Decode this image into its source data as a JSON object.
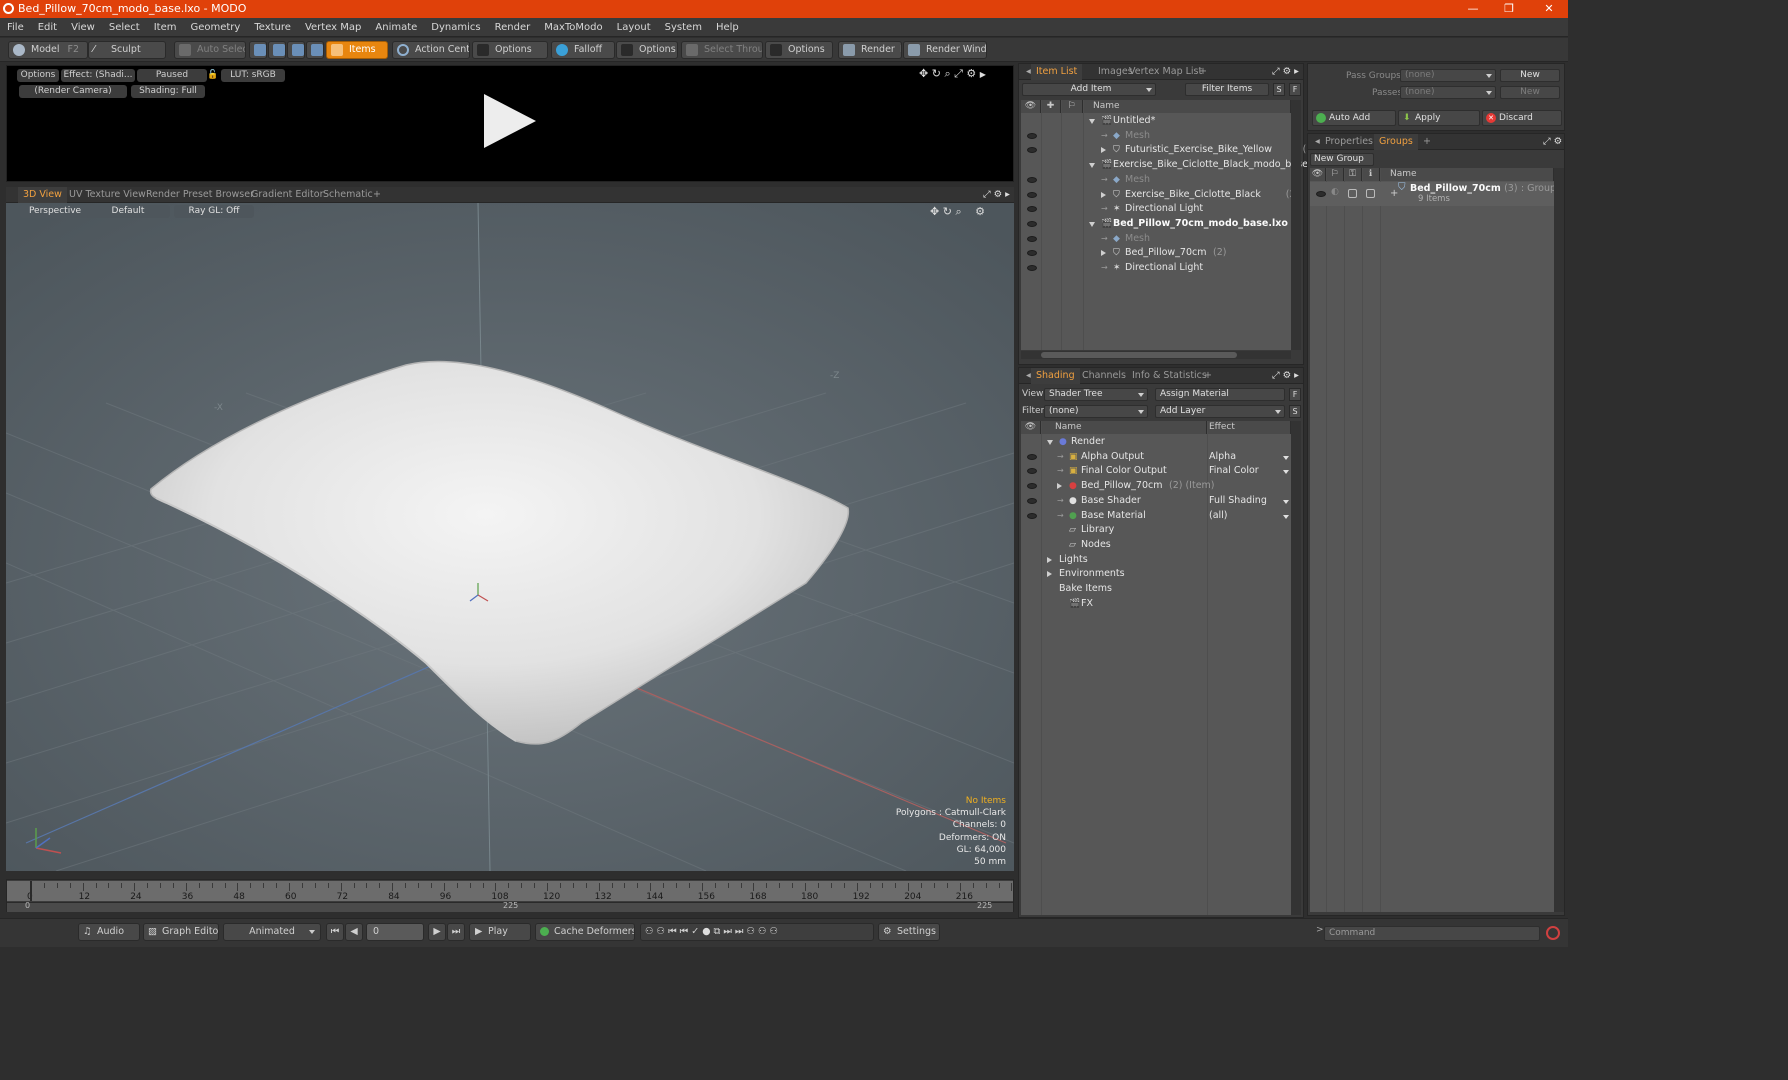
{
  "window": {
    "title": "Bed_Pillow_70cm_modo_base.lxo - MODO",
    "minimize": "—",
    "maximize": "❐",
    "close": "✕"
  },
  "menu": [
    "File",
    "Edit",
    "View",
    "Select",
    "Item",
    "Geometry",
    "Texture",
    "Vertex Map",
    "Animate",
    "Dynamics",
    "Render",
    "MaxToModo",
    "Layout",
    "System",
    "Help"
  ],
  "toolbar": {
    "model": "Model",
    "model_key": "F2",
    "sculpt": "Sculpt",
    "auto_select": "Auto Select",
    "items": "Items",
    "action_center": "Action Center",
    "options1": "Options",
    "falloff": "Falloff",
    "options2": "Options",
    "select_through": "Select Through",
    "options3": "Options",
    "render": "Render",
    "render_key": "F9",
    "render_window": "Render Window"
  },
  "preview": {
    "options": "Options",
    "effect": "Effect: (Shadi...",
    "paused": "Paused",
    "lut": "LUT: sRGB",
    "camera": "(Render Camera)",
    "shading": "Shading: Full"
  },
  "view_tabs": [
    "3D View",
    "UV Texture View",
    "Render Preset Browser",
    "Gradient Editor",
    "Schematic",
    "+"
  ],
  "viewport": {
    "perspective": "Perspective",
    "default": "Default",
    "raygl": "Ray GL: Off",
    "axis_x": "-X",
    "axis_z": "-Z",
    "stats": {
      "no_items": "No Items",
      "polygons": "Polygons : Catmull-Clark",
      "channels": "Channels: 0",
      "deformers": "Deformers: ON",
      "gl": "GL: 64,000",
      "lens": "50 mm"
    }
  },
  "timeline": {
    "ticks": [
      "0",
      "12",
      "24",
      "36",
      "48",
      "60",
      "72",
      "84",
      "96",
      "108",
      "120",
      "132",
      "144",
      "156",
      "168",
      "180",
      "192",
      "204",
      "216"
    ],
    "start": "0",
    "mid": "225",
    "end": "225"
  },
  "bottom": {
    "audio": "Audio",
    "graph_editor": "Graph Editor",
    "animated": "Animated",
    "frame": "0",
    "play": "Play",
    "cache_deformers": "Cache Deformers",
    "settings": "Settings"
  },
  "item_list": {
    "tabs": [
      "Item List",
      "Images",
      "Vertex Map List",
      "+"
    ],
    "add_item": "Add Item",
    "filter_items": "Filter Items",
    "s": "S",
    "f": "F",
    "name_header": "Name",
    "rows": [
      {
        "label": "Untitled*",
        "cnt": ""
      },
      {
        "label": "Mesh",
        "cnt": ""
      },
      {
        "label": "Futuristic_Exercise_Bike_Yellow",
        "cnt": "(2)"
      },
      {
        "label": "Exercise_Bike_Ciclotte_Black_modo_base....",
        "cnt": ""
      },
      {
        "label": "Mesh",
        "cnt": ""
      },
      {
        "label": "Exercise_Bike_Ciclotte_Black",
        "cnt": "(2)"
      },
      {
        "label": "Directional Light",
        "cnt": ""
      },
      {
        "label": "Bed_Pillow_70cm_modo_base.lxo",
        "cnt": ""
      },
      {
        "label": "Mesh",
        "cnt": ""
      },
      {
        "label": "Bed_Pillow_70cm",
        "cnt": "(2)"
      },
      {
        "label": "Directional Light",
        "cnt": ""
      }
    ]
  },
  "shading": {
    "tabs": [
      "Shading",
      "Channels",
      "Info & Statistics",
      "+"
    ],
    "view_label": "View",
    "view_value": "Shader Tree",
    "assign_material": "Assign Material",
    "f": "F",
    "filter_label": "Filter",
    "filter_value": "(none)",
    "add_layer": "Add Layer",
    "s": "S",
    "name_header": "Name",
    "effect_header": "Effect",
    "rows": [
      {
        "label": "Render",
        "effect": ""
      },
      {
        "label": "Alpha Output",
        "effect": "Alpha"
      },
      {
        "label": "Final Color Output",
        "effect": "Final Color"
      },
      {
        "label": "Bed_Pillow_70cm",
        "cnt": "(2) (Item)",
        "effect": ""
      },
      {
        "label": "Base Shader",
        "effect": "Full Shading"
      },
      {
        "label": "Base Material",
        "effect": "(all)"
      },
      {
        "label": "Library",
        "effect": ""
      },
      {
        "label": "Nodes",
        "effect": ""
      },
      {
        "label": "Lights",
        "effect": ""
      },
      {
        "label": "Environments",
        "effect": ""
      },
      {
        "label": "Bake Items",
        "effect": ""
      },
      {
        "label": "FX",
        "effect": ""
      }
    ]
  },
  "pass": {
    "pass_groups": "Pass Groups",
    "passes": "Passes",
    "none1": "(none)",
    "none2": "(none)",
    "new1": "New",
    "new2": "New",
    "auto_add": "Auto Add",
    "apply": "Apply",
    "discard": "Discard"
  },
  "groups": {
    "tabs": [
      "Properties",
      "Groups",
      "+"
    ],
    "new_group": "New Group",
    "name_header": "Name",
    "item_name": "Bed_Pillow_70cm",
    "item_cnt": "(3)",
    "item_type": ": Group",
    "item_sub": "9 Items"
  },
  "command": {
    "placeholder": "Command"
  },
  "colors": {
    "accent": "#f0a040",
    "title_bar": "#e0410a",
    "selected": "#e8860f"
  }
}
